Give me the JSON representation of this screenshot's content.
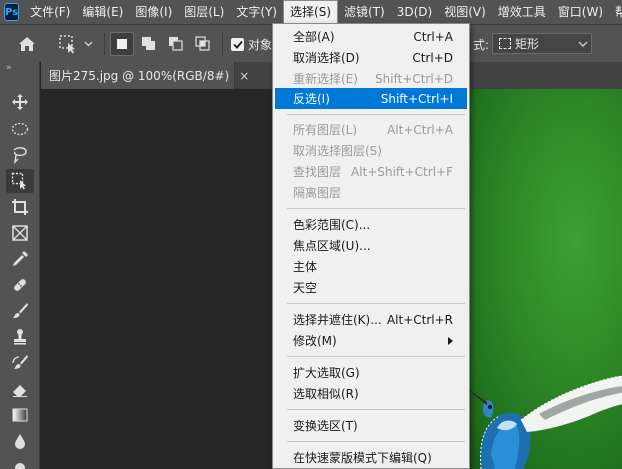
{
  "app": {
    "logo_text": "Ps"
  },
  "menubar": {
    "items": [
      "文件(F)",
      "编辑(E)",
      "图像(I)",
      "图层(L)",
      "文字(Y)",
      "选择(S)",
      "滤镜(T)",
      "3D(D)",
      "视图(V)",
      "增效工具",
      "窗口(W)",
      "帮助(H"
    ],
    "active_index": 5
  },
  "options": {
    "checkbox_label": "对象",
    "mode_label": "式:",
    "mode_value": "矩形"
  },
  "toolbar": {
    "collapse_label": "»"
  },
  "document": {
    "tab_title": "图片275.jpg @ 100%(RGB/8#)",
    "close_label": "×"
  },
  "select_menu": {
    "items": [
      {
        "label": "全部(A)",
        "shortcut": "Ctrl+A",
        "disabled": false
      },
      {
        "label": "取消选择(D)",
        "shortcut": "Ctrl+D",
        "disabled": false
      },
      {
        "label": "重新选择(E)",
        "shortcut": "Shift+Ctrl+D",
        "disabled": true
      },
      {
        "label": "反选(I)",
        "shortcut": "Shift+Ctrl+I",
        "disabled": false,
        "highlighted": true
      },
      {
        "label": "所有图层(L)",
        "shortcut": "Alt+Ctrl+A",
        "disabled": true
      },
      {
        "label": "取消选择图层(S)",
        "shortcut": "",
        "disabled": true
      },
      {
        "label": "查找图层",
        "shortcut": "Alt+Shift+Ctrl+F",
        "disabled": true
      },
      {
        "label": "隔离图层",
        "shortcut": "",
        "disabled": true
      },
      {
        "label": "色彩范围(C)...",
        "shortcut": "",
        "disabled": false
      },
      {
        "label": "焦点区域(U)...",
        "shortcut": "",
        "disabled": false
      },
      {
        "label": "主体",
        "shortcut": "",
        "disabled": false
      },
      {
        "label": "天空",
        "shortcut": "",
        "disabled": false
      },
      {
        "label": "选择并遮住(K)...",
        "shortcut": "Alt+Ctrl+R",
        "disabled": false
      },
      {
        "label": "修改(M)",
        "shortcut": "",
        "disabled": false,
        "submenu": true
      },
      {
        "label": "扩大选取(G)",
        "shortcut": "",
        "disabled": false
      },
      {
        "label": "选取相似(R)",
        "shortcut": "",
        "disabled": false
      },
      {
        "label": "变换选区(T)",
        "shortcut": "",
        "disabled": false
      },
      {
        "label": "在快速蒙版模式下编辑(Q)",
        "shortcut": "",
        "disabled": false
      }
    ]
  },
  "colors": {
    "highlight": "#0078d7",
    "panel": "#535353",
    "canvas": "#282828"
  }
}
